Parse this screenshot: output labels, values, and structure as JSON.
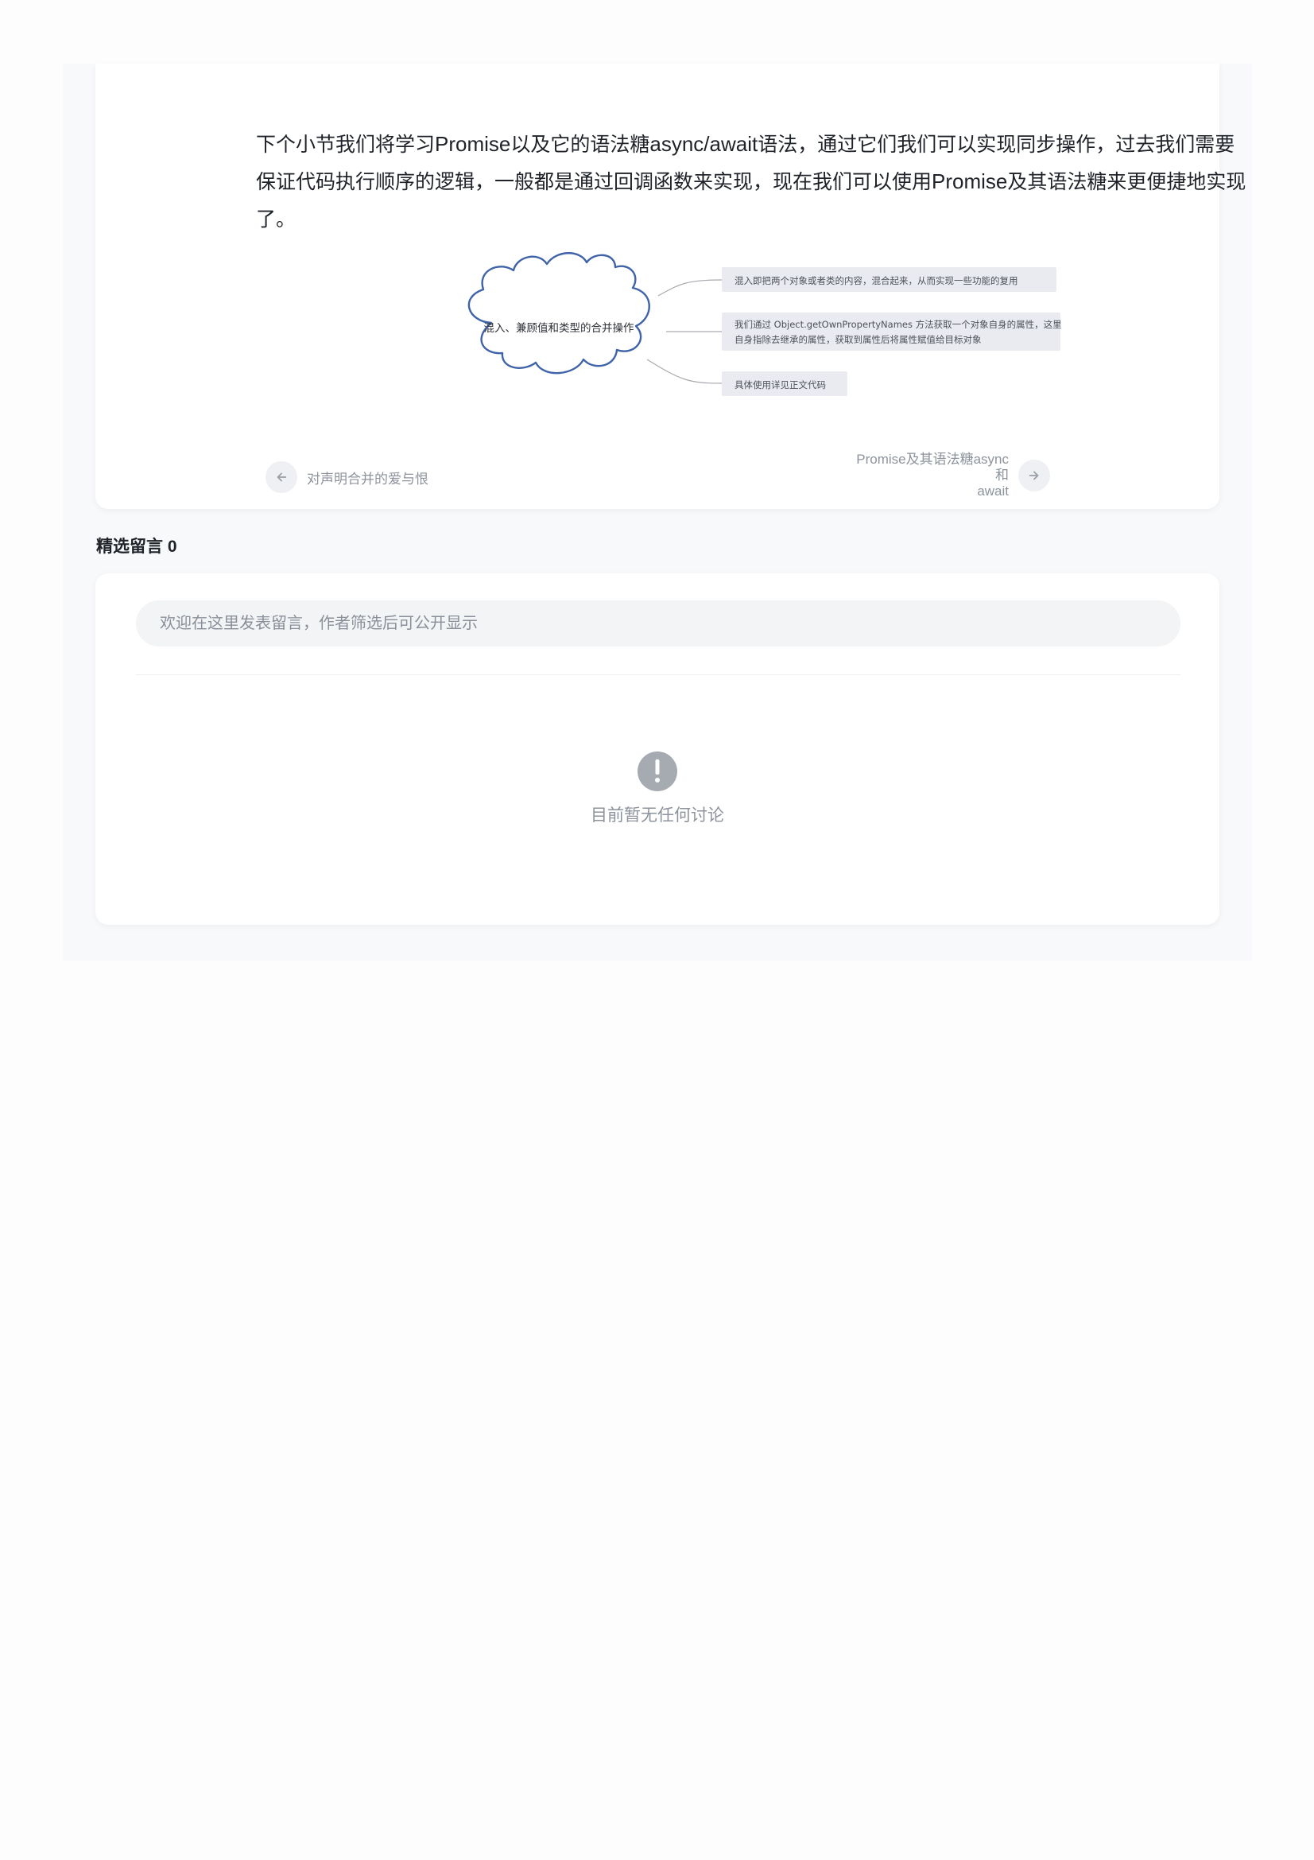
{
  "article": {
    "paragraph_parts": [
      {
        "text": "下个小节我们将学习",
        "type": "zh"
      },
      {
        "text": "Promise",
        "type": "en"
      },
      {
        "text": "以及它的语法糖",
        "type": "zh"
      },
      {
        "text": "async/await",
        "type": "en"
      },
      {
        "text": "语法，通过它们我们可以实现同步操作，过去我们需要保证代码执行顺序的逻辑，一般都是通过回调函数来实现，现在我们可以使用",
        "type": "zh"
      },
      {
        "text": "Promise",
        "type": "en"
      },
      {
        "text": "及其语法糖来更便捷地实现了。",
        "type": "zh"
      }
    ]
  },
  "mindmap": {
    "center_label": "混入、兼顾值和类型的合并操作",
    "branch_1": "混入即把两个对象或者类的内容，混合起来，从而实现一些功能的复用",
    "branch_2_line1": "我们通过 Object.getOwnPropertyNames 方法获取一个对象自身的属性，这里",
    "branch_2_line2": "自身指除去继承的属性，获取到属性后将属性赋值给目标对象",
    "branch_3": "具体使用详见正文代码",
    "colors": {
      "cloud_stroke": "#3f63a8",
      "branch_fill": "#e9ebf1",
      "connector": "#a9a9b0"
    }
  },
  "navigation": {
    "prev_label": "对声明合并的爱与恨",
    "prev_icon": "arrow-left-icon",
    "next_label_line1": "Promise及其语法糖async和",
    "next_label_line2": "await",
    "next_icon": "arrow-right-icon"
  },
  "comments": {
    "title": "精选留言 0",
    "input_placeholder": "欢迎在这里发表留言，作者筛选后可公开显示",
    "empty_icon": "exclamation-icon",
    "empty_text": "目前暂无任何讨论"
  }
}
